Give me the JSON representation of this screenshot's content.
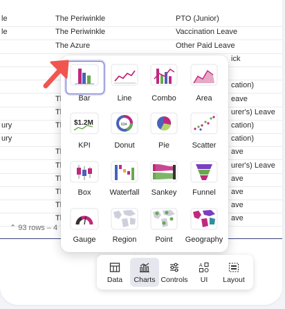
{
  "table": {
    "rows": [
      {
        "c1": "le",
        "c2": "The Periwinkle",
        "c3": "PTO (Junior)"
      },
      {
        "c1": "le",
        "c2": "The Periwinkle",
        "c3": "Vaccination Leave"
      },
      {
        "c1": "",
        "c2": "The Azure",
        "c3": "Other Paid Leave"
      },
      {
        "c1": "",
        "c2": "",
        "c3": "ick"
      },
      {
        "c1": "",
        "c2": "",
        "c3": ""
      },
      {
        "c1": "",
        "c2": "",
        "c3": "cation)"
      },
      {
        "c1": "",
        "c2": "Th",
        "c3": "eave"
      },
      {
        "c1": "",
        "c2": "Th",
        "c3": "urer's) Leave"
      },
      {
        "c1": "",
        "c2": "Th",
        "c3": ""
      },
      {
        "c1": "",
        "c2": "",
        "c3": ""
      },
      {
        "c1": "",
        "c2": "",
        "c3": ""
      },
      {
        "c1": "",
        "c2": "Th",
        "c3": "ave"
      },
      {
        "c1": "",
        "c2": "Th",
        "c3": "urer's) Leave"
      },
      {
        "c1": "",
        "c2": "Th",
        "c3": "cation)"
      },
      {
        "c1": "",
        "c2": "Th",
        "c3": "cation)"
      },
      {
        "c1": "",
        "c2": "Th",
        "c3": "ave"
      },
      {
        "c1": "",
        "c2": "Th",
        "c3": "ave"
      },
      {
        "c1": "",
        "c2": "Th",
        "c3": "ave"
      },
      {
        "c1": "",
        "c2": "Th",
        "c3": "ave"
      },
      {
        "c1": "",
        "c2": "Th",
        "c3": "urer's) Leave"
      },
      {
        "c1": "",
        "c2": "Th",
        "c3": "ave"
      },
      {
        "c1": "",
        "c2": "Th",
        "c3": "eave"
      }
    ],
    "footer": "⌃ 93 rows – 4"
  },
  "bury": [
    "ury",
    "ury"
  ],
  "charts": {
    "tiles": [
      {
        "label": "Bar"
      },
      {
        "label": "Line"
      },
      {
        "label": "Combo"
      },
      {
        "label": "Area"
      },
      {
        "label": "KPI"
      },
      {
        "label": "Donut"
      },
      {
        "label": "Pie"
      },
      {
        "label": "Scatter"
      },
      {
        "label": "Box"
      },
      {
        "label": "Waterfall"
      },
      {
        "label": "Sankey"
      },
      {
        "label": "Funnel"
      },
      {
        "label": "Gauge"
      },
      {
        "label": "Region"
      },
      {
        "label": "Point"
      },
      {
        "label": "Geography"
      }
    ],
    "kpi_text": "$1.2M",
    "donut_text": "634"
  },
  "toolbar": {
    "items": [
      {
        "label": "Data"
      },
      {
        "label": "Charts"
      },
      {
        "label": "Controls"
      },
      {
        "label": "UI"
      },
      {
        "label": "Layout"
      }
    ]
  },
  "colors": {
    "accent": "#6b6fc7",
    "magenta": "#c0287e",
    "green": "#6aa84f",
    "arrow": "#f0564f"
  }
}
